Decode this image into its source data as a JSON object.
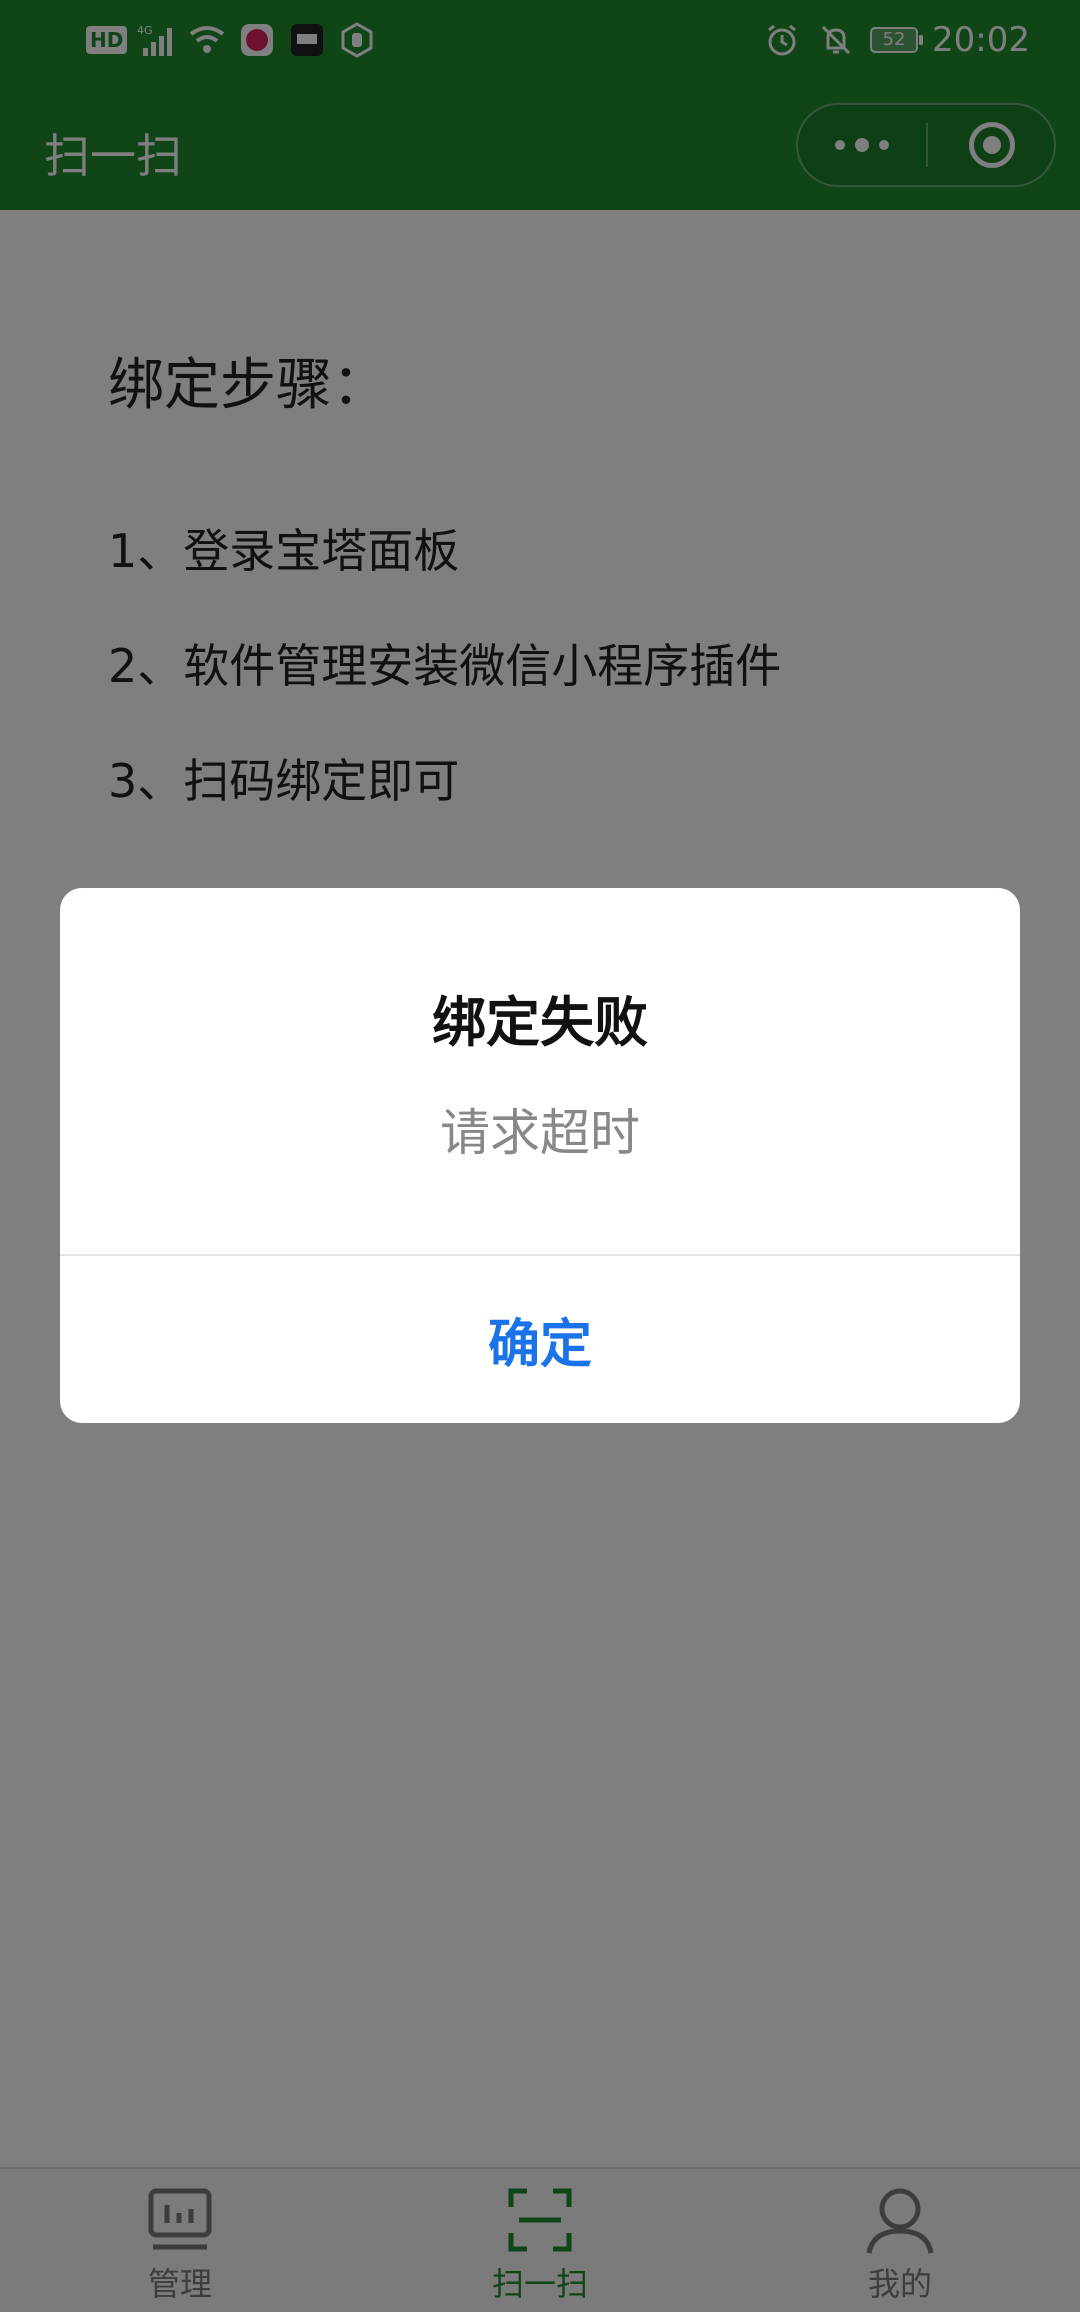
{
  "status_bar": {
    "network_badge": "HD",
    "network_type": "4G",
    "battery_level": "52",
    "time": "20:02"
  },
  "nav": {
    "title": "扫一扫"
  },
  "content": {
    "steps_title": "绑定步骤：",
    "steps": [
      "1、登录宝塔面板",
      "2、软件管理安装微信小程序插件",
      "3、扫码绑定即可"
    ]
  },
  "tabs": [
    {
      "label": "管理",
      "icon": "dashboard-icon",
      "active": false
    },
    {
      "label": "扫一扫",
      "icon": "scan-icon",
      "active": true
    },
    {
      "label": "我的",
      "icon": "user-icon",
      "active": false
    }
  ],
  "modal": {
    "title": "绑定失败",
    "message": "请求超时",
    "confirm_label": "确定"
  },
  "colors": {
    "brand_green": "#1f8a2e",
    "confirm_blue": "#1a73e8"
  }
}
